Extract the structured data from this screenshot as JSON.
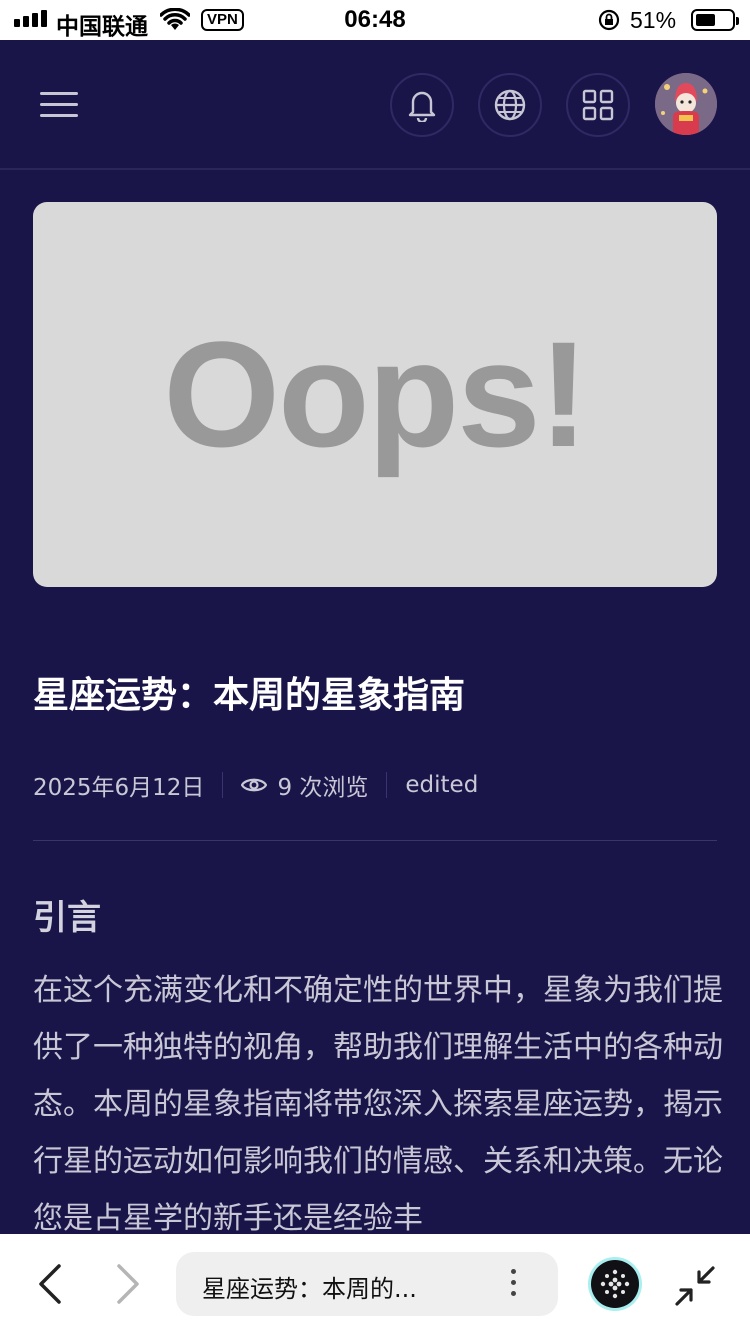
{
  "status_bar": {
    "carrier": "中国联通",
    "vpn": "VPN",
    "time": "06:48",
    "battery": "51%"
  },
  "header": {
    "icons": [
      "menu-icon",
      "bell-icon",
      "globe-icon",
      "grid-icon",
      "avatar"
    ]
  },
  "hero": {
    "placeholder_text": "Oops!",
    "background": "#d9d9d9"
  },
  "article": {
    "title": "星座运势：本周的星象指南",
    "date": "2025年6月12日",
    "views": "9 次浏览",
    "status": "edited",
    "section_heading": "引言",
    "body": "在这个充满变化和不确定性的世界中，星象为我们提供了一种独特的视角，帮助我们理解生活中的各种动态。本周的星象指南将带您深入探索星座运势，揭示行星的运动如何影响我们的情感、关系和决策。无论您是占星学的新手还是经验丰"
  },
  "browser": {
    "page_title": "星座运势：本周的..."
  },
  "colors": {
    "background": "#1a1549",
    "text": "#ffffff",
    "muted_text": "#c8c7d6"
  }
}
